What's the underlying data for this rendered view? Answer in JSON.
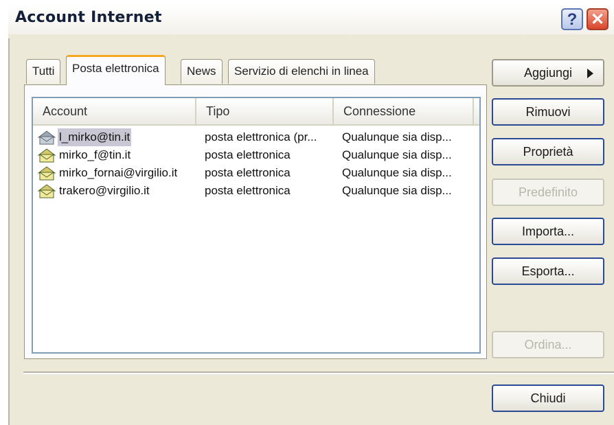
{
  "window": {
    "title": "Account Internet"
  },
  "titlebar_buttons": {
    "help": "?",
    "close": "✕"
  },
  "tabs": [
    {
      "label": "Tutti",
      "active": false
    },
    {
      "label": "Posta elettronica",
      "active": true
    },
    {
      "label": "News",
      "active": false
    },
    {
      "label": "Servizio di elenchi in linea",
      "active": false
    }
  ],
  "list": {
    "columns": [
      "Account",
      "Tipo",
      "Connessione"
    ],
    "rows": [
      {
        "account": "l_mirko@tin.it",
        "tipo": "posta elettronica (pr...",
        "connessione": "Qualunque sia disp...",
        "selected": true,
        "icon": "mail-account-icon-default"
      },
      {
        "account": "mirko_f@tin.it",
        "tipo": "posta elettronica",
        "connessione": "Qualunque sia disp...",
        "selected": false,
        "icon": "mail-account-icon"
      },
      {
        "account": "mirko_fornai@virgilio.it",
        "tipo": "posta elettronica",
        "connessione": "Qualunque sia disp...",
        "selected": false,
        "icon": "mail-account-icon"
      },
      {
        "account": "trakero@virgilio.it",
        "tipo": "posta elettronica",
        "connessione": "Qualunque sia disp...",
        "selected": false,
        "icon": "mail-account-icon"
      }
    ]
  },
  "buttons": {
    "add": "Aggiungi",
    "remove": "Rimuovi",
    "properties": "Proprietà",
    "set_default": "Predefinito",
    "import": "Importa...",
    "export": "Esporta...",
    "order": "Ordina...",
    "close": "Chiudi"
  },
  "colors": {
    "selection": "#c9c7d3",
    "button_border": "#2a4a95",
    "tab_accent": "#f5a623"
  }
}
